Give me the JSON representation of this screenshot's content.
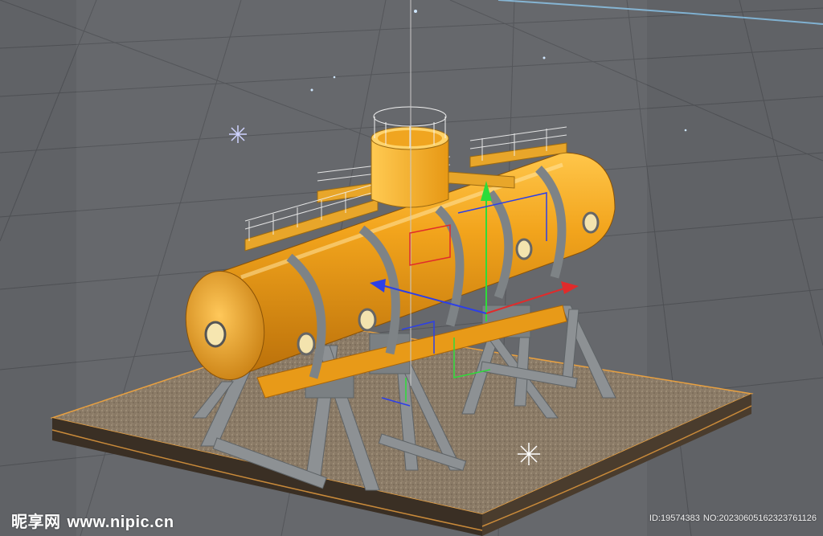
{
  "viewport": {
    "background": "#606266",
    "grid_color": "#4e5054",
    "scene": "3D model of an orange pressurized tank on steel support frames on a soil base"
  },
  "colors": {
    "tank": "#f2a41c",
    "tank_shadow": "#b96f0a",
    "frame": "#8d9194",
    "ground": "#8a7a66",
    "axis_x": "#e02b2b",
    "axis_y": "#2ddc3a",
    "axis_z": "#2c3fe8"
  },
  "watermark": {
    "site_logo": "昵享网",
    "site_url": "www.nipic.cn",
    "id_text": "ID:19574383",
    "no_text": "NO:20230605162323761126"
  }
}
